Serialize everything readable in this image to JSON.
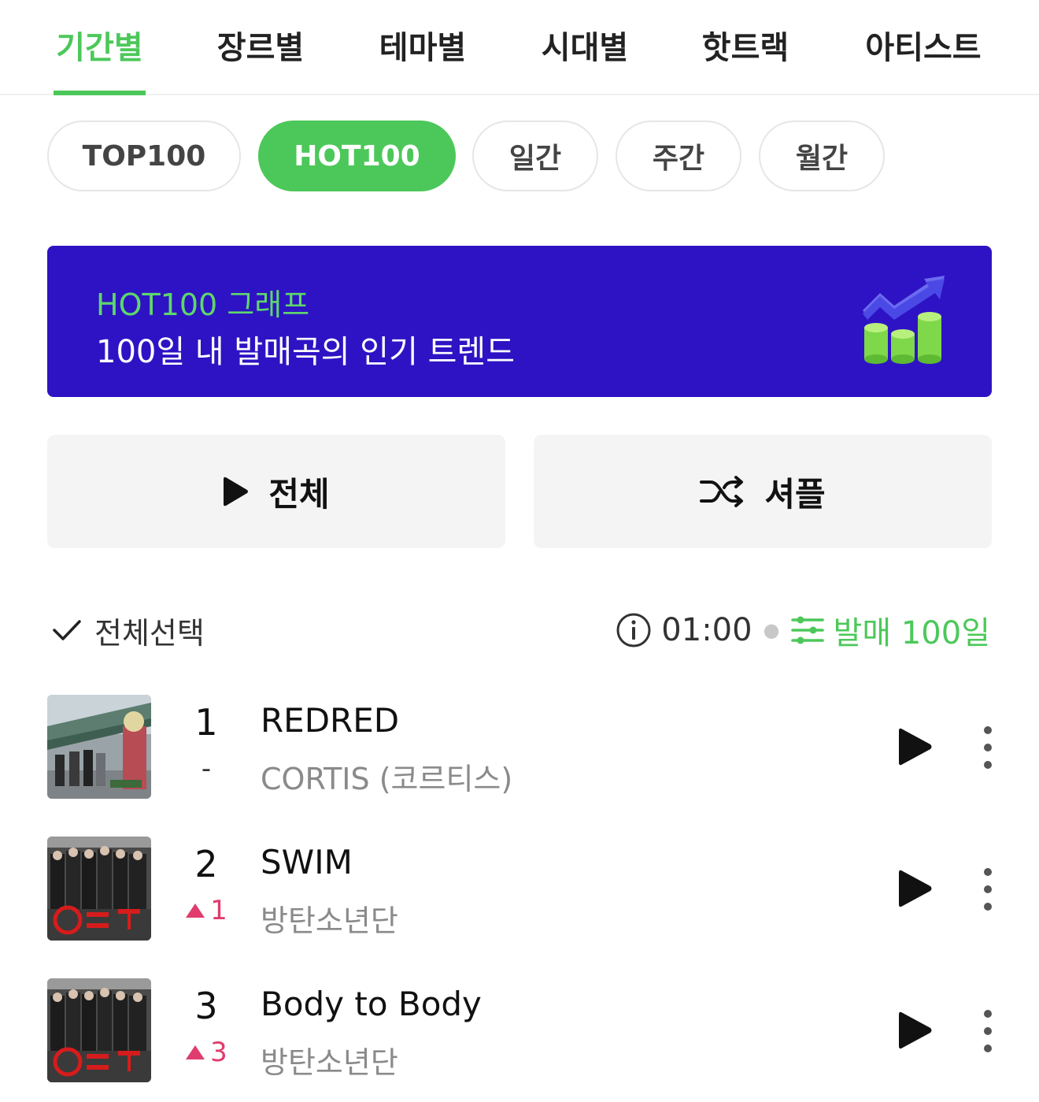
{
  "top_tabs": [
    "기간별",
    "장르별",
    "테마별",
    "시대별",
    "핫트랙",
    "아티스트"
  ],
  "pills": [
    "TOP100",
    "HOT100",
    "일간",
    "주간",
    "월간"
  ],
  "banner": {
    "title": "HOT100 그래프",
    "subtitle": "100일 내 발매곡의 인기 트렌드"
  },
  "actions": {
    "play_all": "전체",
    "shuffle": "셔플"
  },
  "select_all": "전체선택",
  "meta": {
    "time": "01:00",
    "filter": "발매 100일"
  },
  "tracks": [
    {
      "rank": "1",
      "change": "-",
      "title": "REDRED",
      "artist": "CORTIS (코르티스)"
    },
    {
      "rank": "2",
      "change": "1",
      "title": "SWIM",
      "artist": "방탄소년단"
    },
    {
      "rank": "3",
      "change": "3",
      "title": "Body to Body",
      "artist": "방탄소년단"
    }
  ],
  "colors": {
    "accent": "#4cc85a",
    "banner": "#2e13c4",
    "up": "#e03c6e"
  }
}
